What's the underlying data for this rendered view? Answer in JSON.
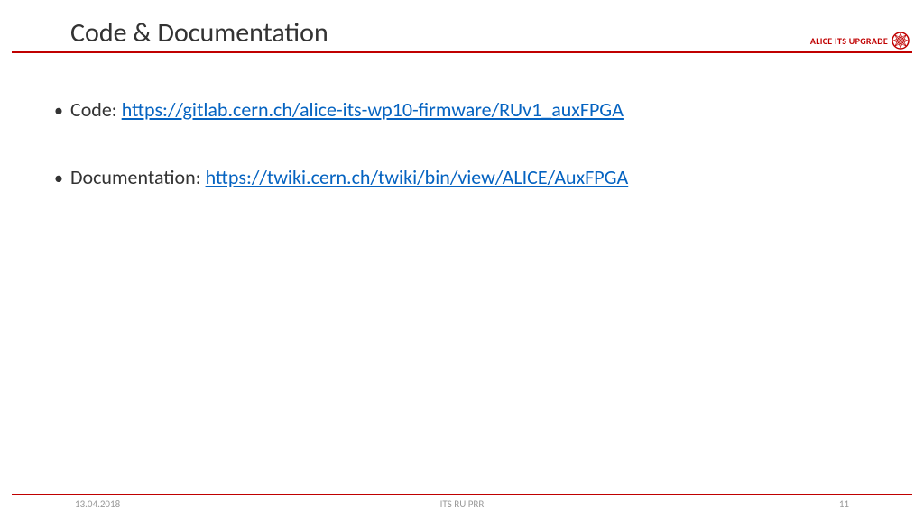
{
  "header": {
    "title": "Code & Documentation",
    "brand": "ALICE ITS UPGRADE"
  },
  "content": {
    "items": [
      {
        "label": "Code:",
        "link": "https://gitlab.cern.ch/alice-its-wp10-firmware/RUv1_auxFPGA"
      },
      {
        "label": "Documentation:",
        "link": "https://twiki.cern.ch/twiki/bin/view/ALICE/AuxFPGA"
      }
    ]
  },
  "footer": {
    "date": "13.04.2018",
    "center": "ITS RU PRR",
    "page": "11"
  }
}
